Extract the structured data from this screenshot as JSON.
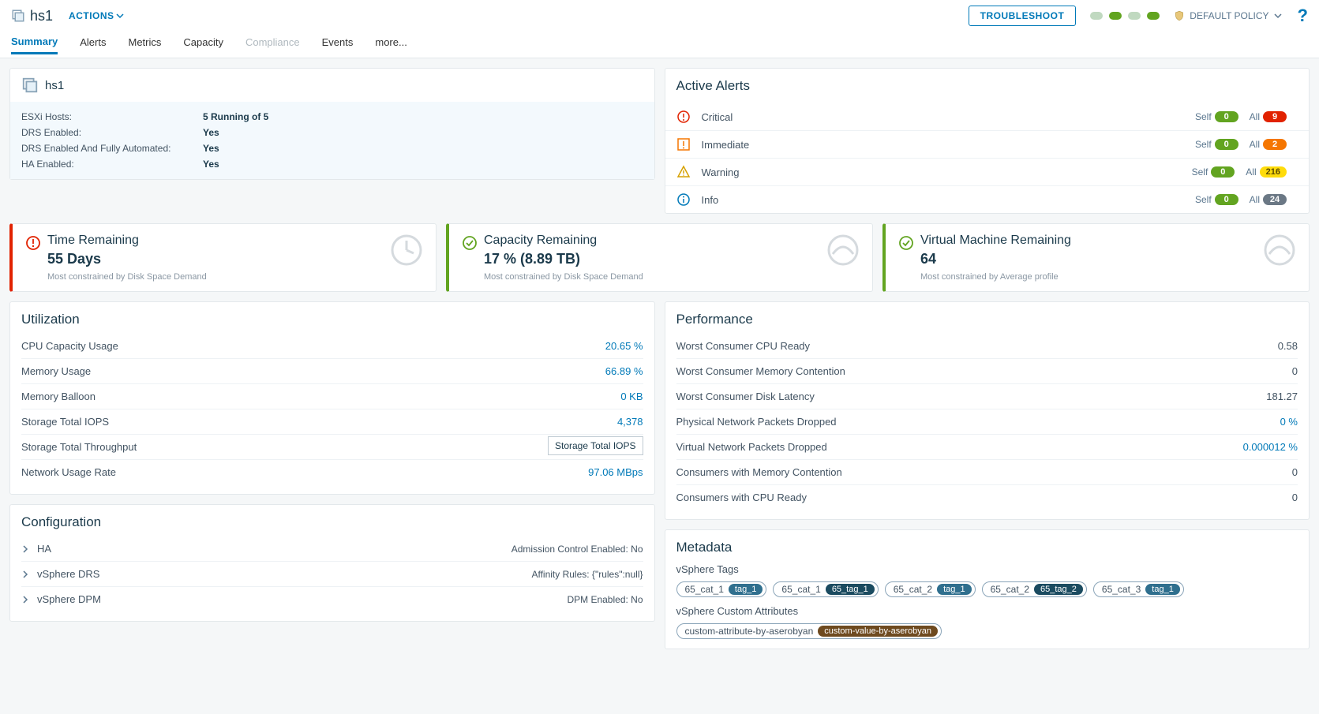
{
  "header": {
    "title": "hs1",
    "actions_label": "ACTIONS",
    "troubleshoot": "TROUBLESHOOT",
    "policy_label": "DEFAULT POLICY"
  },
  "tabs": [
    "Summary",
    "Alerts",
    "Metrics",
    "Capacity",
    "Compliance",
    "Events",
    "more..."
  ],
  "cluster": {
    "name": "hs1",
    "rows": [
      {
        "k": "ESXi Hosts:",
        "v": "5 Running of 5"
      },
      {
        "k": "DRS Enabled:",
        "v": "Yes"
      },
      {
        "k": "DRS Enabled And Fully Automated:",
        "v": "Yes"
      },
      {
        "k": "HA Enabled:",
        "v": "Yes"
      }
    ]
  },
  "active_alerts": {
    "title": "Active Alerts",
    "rows": [
      {
        "name": "Critical",
        "self": "0",
        "all": "9",
        "color": "red"
      },
      {
        "name": "Immediate",
        "self": "0",
        "all": "2",
        "color": "orange"
      },
      {
        "name": "Warning",
        "self": "0",
        "all": "216",
        "color": "yellow"
      },
      {
        "name": "Info",
        "self": "0",
        "all": "24",
        "color": "grey"
      }
    ],
    "self_label": "Self",
    "all_label": "All"
  },
  "summary_cards": [
    {
      "color": "red",
      "title": "Time Remaining",
      "value": "55 Days",
      "foot": "Most constrained by Disk Space Demand",
      "icon": "clock"
    },
    {
      "color": "green",
      "title": "Capacity Remaining",
      "value": "17 % (8.89 TB)",
      "foot": "Most constrained by Disk Space Demand",
      "icon": "gauge"
    },
    {
      "color": "green",
      "title": "Virtual Machine Remaining",
      "value": "64",
      "foot": "Most constrained by Average profile",
      "icon": "gauge"
    }
  ],
  "utilization": {
    "title": "Utilization",
    "rows": [
      {
        "name": "CPU Capacity Usage",
        "value": "20.65 %",
        "link": true
      },
      {
        "name": "Memory Usage",
        "value": "66.89 %",
        "link": true
      },
      {
        "name": "Memory Balloon",
        "value": "0 KB",
        "link": true
      },
      {
        "name": "Storage Total IOPS",
        "value": "4,378",
        "link": true
      },
      {
        "name": "Storage Total Throughput",
        "value": "",
        "link": true
      },
      {
        "name": "Network Usage Rate",
        "value": "97.06 MBps",
        "link": true
      }
    ],
    "tooltip": "Storage Total IOPS"
  },
  "performance": {
    "title": "Performance",
    "rows": [
      {
        "name": "Worst Consumer CPU Ready",
        "value": "0.58"
      },
      {
        "name": "Worst Consumer Memory Contention",
        "value": "0"
      },
      {
        "name": "Worst Consumer Disk Latency",
        "value": "181.27"
      },
      {
        "name": "Physical Network Packets Dropped",
        "value": "0 %",
        "link": true
      },
      {
        "name": "Virtual Network Packets Dropped",
        "value": "0.000012 %",
        "link": true
      },
      {
        "name": "Consumers with Memory Contention",
        "value": "0"
      },
      {
        "name": "Consumers with CPU Ready",
        "value": "0"
      }
    ]
  },
  "configuration": {
    "title": "Configuration",
    "rows": [
      {
        "name": "HA",
        "value": "Admission Control Enabled: No"
      },
      {
        "name": "vSphere DRS",
        "value": "Affinity Rules: {\"rules\":null}"
      },
      {
        "name": "vSphere DPM",
        "value": "DPM Enabled: No"
      }
    ]
  },
  "metadata": {
    "title": "Metadata",
    "tags_label": "vSphere Tags",
    "tags": [
      {
        "cat": "65_cat_1",
        "tag": "tag_1",
        "style": "normal"
      },
      {
        "cat": "65_cat_1",
        "tag": "65_tag_1",
        "style": "dark"
      },
      {
        "cat": "65_cat_2",
        "tag": "tag_1",
        "style": "normal"
      },
      {
        "cat": "65_cat_2",
        "tag": "65_tag_2",
        "style": "dark"
      },
      {
        "cat": "65_cat_3",
        "tag": "tag_1",
        "style": "normal"
      }
    ],
    "attrs_label": "vSphere Custom Attributes",
    "attrs": [
      {
        "k": "custom-attribute-by-aserobyan",
        "v": "custom-value-by-aserobyan"
      }
    ]
  }
}
